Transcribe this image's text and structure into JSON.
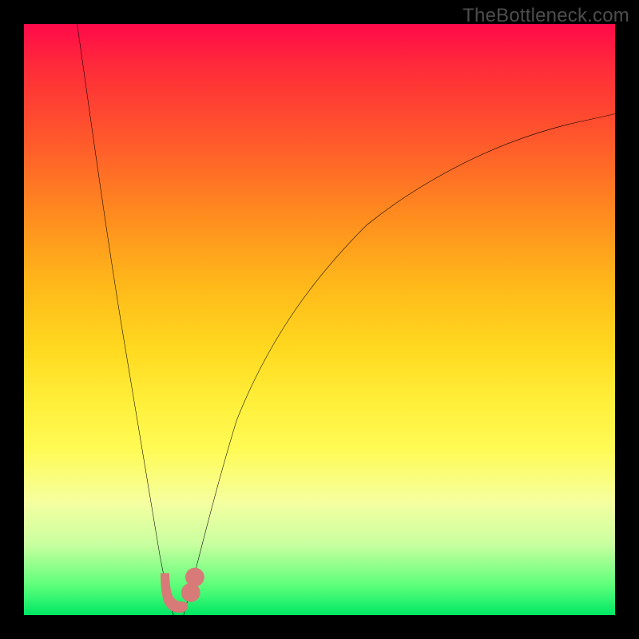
{
  "watermark": "TheBottleneck.com",
  "colors": {
    "frame": "#000000",
    "curve": "#000000",
    "marker": "#d87a77",
    "gradient_top": "#ff0a4a",
    "gradient_bottom": "#00e765"
  },
  "chart_data": {
    "type": "line",
    "title": "",
    "xlabel": "",
    "ylabel": "",
    "xlim": [
      0,
      100
    ],
    "ylim": [
      0,
      100
    ],
    "grid": false,
    "legend": false,
    "series": [
      {
        "name": "left-branch",
        "x": [
          9,
          10,
          12,
          14,
          16,
          18,
          20,
          22,
          23,
          24,
          25
        ],
        "y": [
          100,
          90,
          72,
          56,
          42,
          30,
          20,
          11,
          7,
          3,
          0
        ]
      },
      {
        "name": "right-branch",
        "x": [
          27,
          30,
          34,
          38,
          44,
          50,
          56,
          64,
          72,
          82,
          92,
          100
        ],
        "y": [
          0,
          11,
          25,
          37,
          49,
          58,
          65,
          71,
          76,
          80,
          83,
          85
        ]
      }
    ],
    "annotations": [
      {
        "name": "marker-cluster",
        "description": "large rounded pink markers near the minimum / green zone",
        "points": [
          {
            "x": 23.3,
            "y": 6.1
          },
          {
            "x": 23.5,
            "y": 4.2
          },
          {
            "x": 23.9,
            "y": 2.5
          },
          {
            "x": 24.5,
            "y": 1.3
          },
          {
            "x": 25.4,
            "y": 0.5
          },
          {
            "x": 26.4,
            "y": 0.5
          },
          {
            "x": 27.2,
            "y": 1.3
          },
          {
            "x": 28.0,
            "y": 3.6
          },
          {
            "x": 28.7,
            "y": 6.4
          }
        ]
      }
    ]
  }
}
